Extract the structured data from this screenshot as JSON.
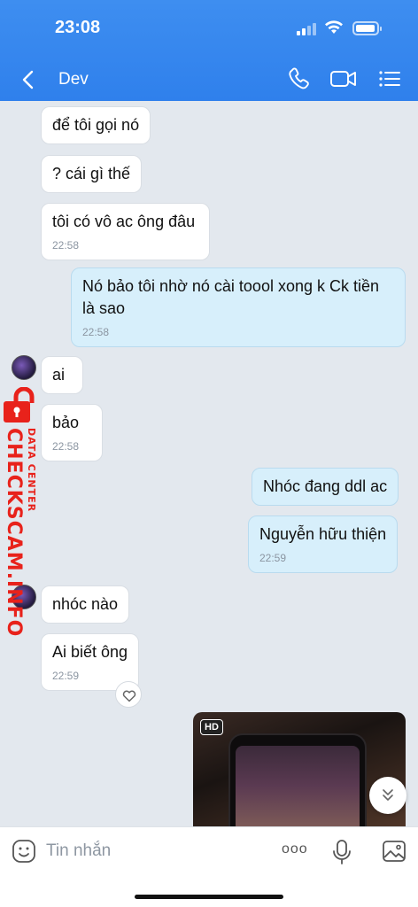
{
  "status_bar": {
    "time": "23:08"
  },
  "header": {
    "title": "Dev"
  },
  "messages": [
    {
      "text": "để tôi gọi nó"
    },
    {
      "text": "? cái gì thế"
    },
    {
      "text": "tôi có vô ac  ông đâu",
      "time": "22:58"
    },
    {
      "text": "Nó bảo tôi nhờ nó cài toool xong k Ck tiền",
      "text2": "là sao",
      "time": "22:58"
    },
    {
      "text": "ai"
    },
    {
      "text": "bảo",
      "time": "22:58"
    },
    {
      "text": "Nhóc đang ddl ac"
    },
    {
      "text": "Nguyễn hữu thiện",
      "time": "22:59"
    },
    {
      "text": "nhóc nào"
    },
    {
      "text": "Ai biết ông",
      "time": "22:59"
    }
  ],
  "watermark": {
    "main": "CHECKSCAM.INFO",
    "sub": "DATA CENTER"
  },
  "video": {
    "badge": "HD"
  },
  "composer": {
    "placeholder": "Tin nhắn",
    "more": "ooo"
  },
  "colors": {
    "header": "#2f80ec",
    "outgoing_bubble": "#d7effb",
    "incoming_bubble": "#ffffff",
    "background": "#e3e8ee",
    "watermark": "#e8221b"
  }
}
